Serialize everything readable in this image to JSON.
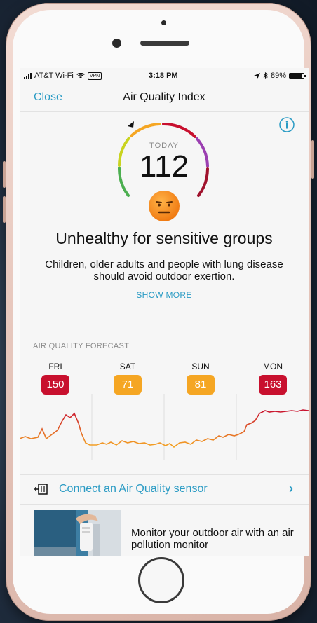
{
  "status_bar": {
    "carrier": "AT&T Wi-Fi",
    "vpn": "VPN",
    "time": "3:18 PM",
    "battery": "89%"
  },
  "navbar": {
    "close_label": "Close",
    "title": "Air Quality Index"
  },
  "aqi": {
    "today_label": "TODAY",
    "value": "112",
    "category": "Unhealthy for sensitive groups",
    "description": "Children, older adults and people with lung disease should avoid outdoor exertion.",
    "show_more": "SHOW MORE",
    "icons": {
      "info": "info-icon",
      "face": "unamused-face-icon"
    }
  },
  "forecast": {
    "label": "AIR QUALITY FORECAST",
    "days": [
      {
        "day": "FRI",
        "value": "150",
        "color": "#c8102e"
      },
      {
        "day": "SAT",
        "value": "71",
        "color": "#f5a623"
      },
      {
        "day": "SUN",
        "value": "81",
        "color": "#f5a623"
      },
      {
        "day": "MON",
        "value": "163",
        "color": "#c8102e"
      }
    ]
  },
  "connect": {
    "label": "Connect an Air Quality sensor",
    "icon": "sensor-icon",
    "chevron": "›"
  },
  "promo": {
    "text": "Monitor your outdoor air with an air pollution monitor"
  },
  "colors": {
    "accent": "#2a9bc4",
    "unhealthy": "#c8102e",
    "moderate": "#f5a623"
  }
}
